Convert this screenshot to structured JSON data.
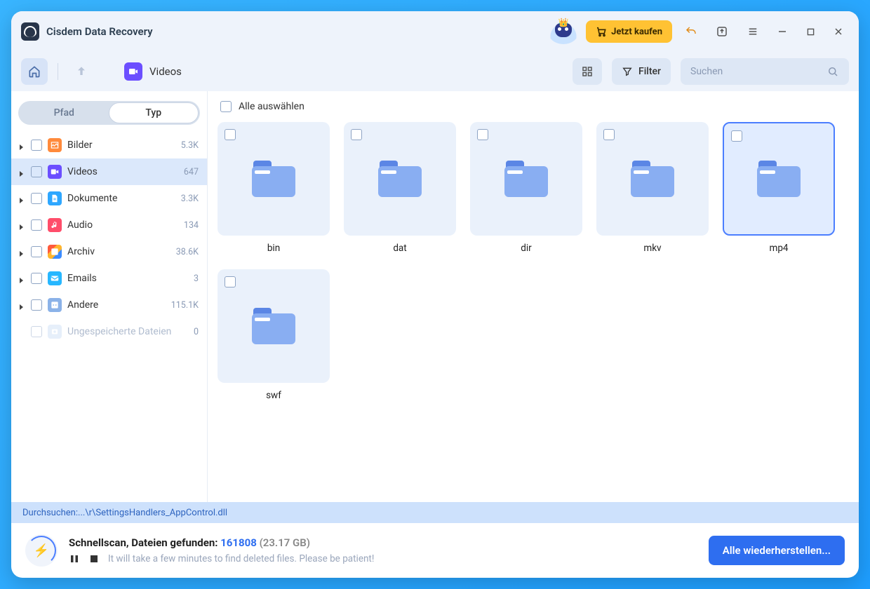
{
  "app": {
    "title": "Cisdem Data Recovery"
  },
  "titlebar": {
    "buy_label": "Jetzt kaufen"
  },
  "toolbar": {
    "breadcrumb_label": "Videos",
    "filter_label": "Filter",
    "search_placeholder": "Suchen"
  },
  "sidebar": {
    "tab_path": "Pfad",
    "tab_type": "Typ",
    "items": [
      {
        "label": "Bilder",
        "count": "5.3K",
        "color": "#ff8a3c",
        "icon": "image"
      },
      {
        "label": "Videos",
        "count": "647",
        "color": "#6b4eff",
        "icon": "video",
        "active": true
      },
      {
        "label": "Dokumente",
        "count": "3.3K",
        "color": "#2ea7ff",
        "icon": "doc"
      },
      {
        "label": "Audio",
        "count": "134",
        "color": "#ff4d6a",
        "icon": "audio"
      },
      {
        "label": "Archiv",
        "count": "38.6K",
        "color": "#ff9d2e",
        "icon": "archive",
        "multicolor": true
      },
      {
        "label": "Emails",
        "count": "3",
        "color": "#27b7ff",
        "icon": "mail"
      },
      {
        "label": "Andere",
        "count": "115.1K",
        "color": "#8bb2e8",
        "icon": "other"
      }
    ],
    "unsaved": {
      "label": "Ungespeicherte Dateien",
      "count": "0"
    }
  },
  "content": {
    "select_all_label": "Alle auswählen",
    "folders": [
      {
        "name": "bin"
      },
      {
        "name": "dat"
      },
      {
        "name": "dir"
      },
      {
        "name": "mkv"
      },
      {
        "name": "mp4",
        "selected": true
      },
      {
        "name": "swf"
      }
    ]
  },
  "status": {
    "scan_prefix": "Durchsuchen: ",
    "scan_path": "...\\r\\SettingsHandlers_AppControl.dll",
    "summary_prefix": "Schnellscan, Dateien gefunden: ",
    "summary_count": "161808",
    "summary_size": "(23.17 GB)",
    "hint": "It will take a few minutes to find deleted files. Please be patient!",
    "recover_label": "Alle wiederherstellen..."
  }
}
